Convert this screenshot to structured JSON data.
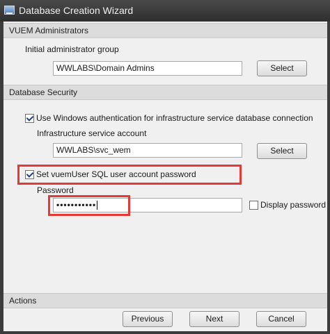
{
  "window": {
    "title": "Database Creation Wizard",
    "app_icon": "window-icon"
  },
  "vuem_admins": {
    "header": "VUEM Administrators",
    "group_label": "Initial administrator group",
    "group_value": "WWLABS\\Domain Admins",
    "select_label": "Select"
  },
  "db_security": {
    "header": "Database Security",
    "windows_auth_label": "Use Windows authentication for infrastructure service database connection",
    "windows_auth_checked": true,
    "account_label": "Infrastructure service account",
    "account_value": "WWLABS\\svc_wem",
    "select_label": "Select",
    "vuemuser_label": "Set vuemUser SQL user account password",
    "vuemuser_checked": true,
    "password_label": "Password",
    "password_value": "•••••••••••",
    "display_password_label": "Display password",
    "display_password_checked": false,
    "highlight_color": "#e53935"
  },
  "actions": {
    "header": "Actions",
    "previous_label": "Previous",
    "next_label": "Next",
    "cancel_label": "Cancel"
  }
}
